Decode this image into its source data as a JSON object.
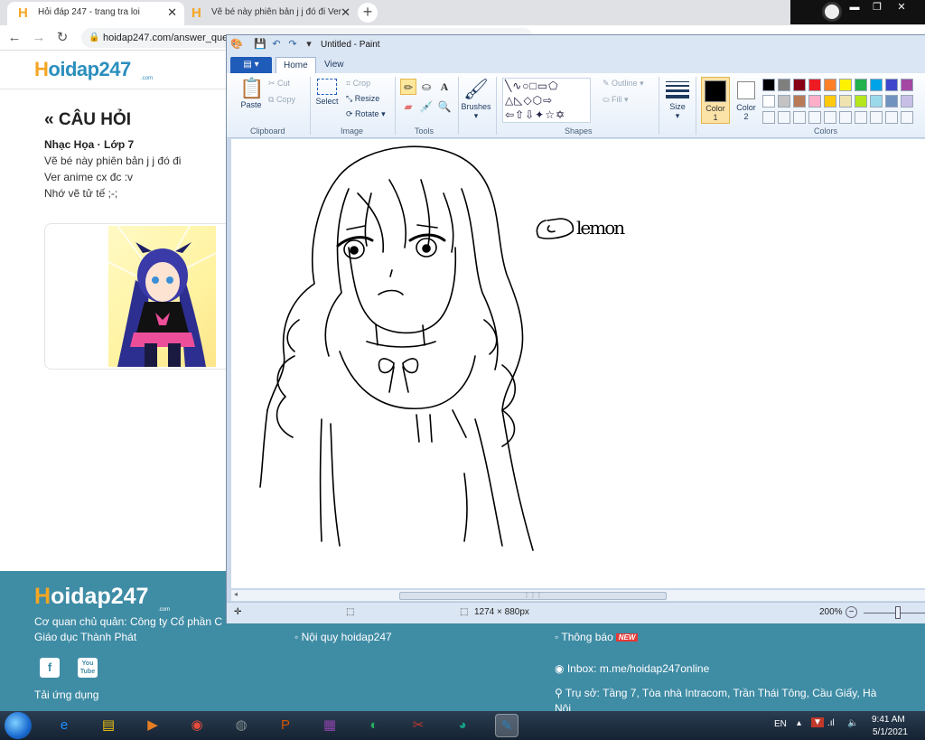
{
  "browser": {
    "tabs": [
      {
        "title": "Hỏi đáp 247 - trang tra loi",
        "active": true
      },
      {
        "title": "Vẽ bé này phiên bản j j đó đi Ver",
        "active": false
      }
    ],
    "new_tab": "+",
    "url": "hoidap247.com/answer_que",
    "window_controls": {
      "minimize": "▬",
      "maximize": "❐",
      "close": "✕"
    }
  },
  "page": {
    "logo": {
      "h": "H",
      "rest": "oidap247",
      "com": ".com"
    },
    "section_title": "« CÂU HỎI",
    "subject": "Nhạc Họa · Lớp 7",
    "question_lines": [
      "Vẽ bé này phiên bản j j đó đi",
      "Ver anime cx đc :v",
      "Nhớ vẽ tử tế ;-;"
    ]
  },
  "footer": {
    "logo": {
      "h": "H",
      "rest": "oidap247",
      "com": ".com"
    },
    "agency_line1": "Cơ quan chủ quản: Công ty Cổ phần C",
    "agency_line2": "Giáo dục Thành Phát",
    "social": {
      "facebook": "f",
      "youtube_top": "You",
      "youtube_bottom": "Tube"
    },
    "app_download": "Tải ứng dụng",
    "rules_link": "Nội quy hoidap247",
    "notifications": "Thông báo",
    "new_badge": "NEW",
    "inbox": "Inbox: m.me/hoidap247online",
    "address_line1": "Trụ sở: Tầng 7, Tòa nhà Intracom, Trần Thái Tông, Cầu Giấy, Hà",
    "address_line2": "Nội"
  },
  "paint": {
    "title": "Untitled - Paint",
    "ribbon_tabs": {
      "file": "▤ ▾",
      "home": "Home",
      "view": "View"
    },
    "clipboard": {
      "paste": "Paste",
      "cut": "Cut",
      "copy": "Copy",
      "group": "Clipboard"
    },
    "image": {
      "select": "Select",
      "crop": "Crop",
      "resize": "Resize",
      "rotate": "Rotate",
      "group": "Image"
    },
    "tools_group": "Tools",
    "brushes": "Brushes",
    "shapes": {
      "outline": "Outline",
      "fill": "Fill",
      "group": "Shapes"
    },
    "size": "Size",
    "color1": {
      "label": "Color",
      "num": "1"
    },
    "color2": {
      "label": "Color",
      "num": "2"
    },
    "colors_group": "Colors",
    "palette_row1": [
      "#000000",
      "#7f7f7f",
      "#880015",
      "#ed1c24",
      "#ff7f27",
      "#fff200",
      "#22b14c",
      "#00a2e8",
      "#3f48cc",
      "#a349a4"
    ],
    "palette_row2": [
      "#ffffff",
      "#c3c3c3",
      "#b97a57",
      "#ffaec9",
      "#ffc90e",
      "#efe4b0",
      "#b5e61d",
      "#99d9ea",
      "#7092be",
      "#c8bfe7"
    ],
    "signature": "lemon",
    "status": {
      "dimensions": "1274 × 880px",
      "zoom": "200%"
    }
  },
  "taskbar": {
    "apps": [
      {
        "icon": "e",
        "color": "#1e90ff"
      },
      {
        "icon": "▤",
        "color": "#f1c40f"
      },
      {
        "icon": "▶",
        "color": "#e67e22"
      },
      {
        "icon": "◉",
        "color": "#e74c3c"
      },
      {
        "icon": "◍",
        "color": "#7f8c8d"
      },
      {
        "icon": "P",
        "color": "#d35400"
      },
      {
        "icon": "▦",
        "color": "#8e44ad"
      },
      {
        "icon": "◐",
        "color": "#27ae60"
      },
      {
        "icon": "✂",
        "color": "#c0392b"
      },
      {
        "icon": "◕",
        "color": "#16a085"
      },
      {
        "icon": "✎",
        "color": "#2980b9"
      }
    ],
    "lang": "EN",
    "time": "9:41 AM",
    "date": "5/1/2021"
  }
}
